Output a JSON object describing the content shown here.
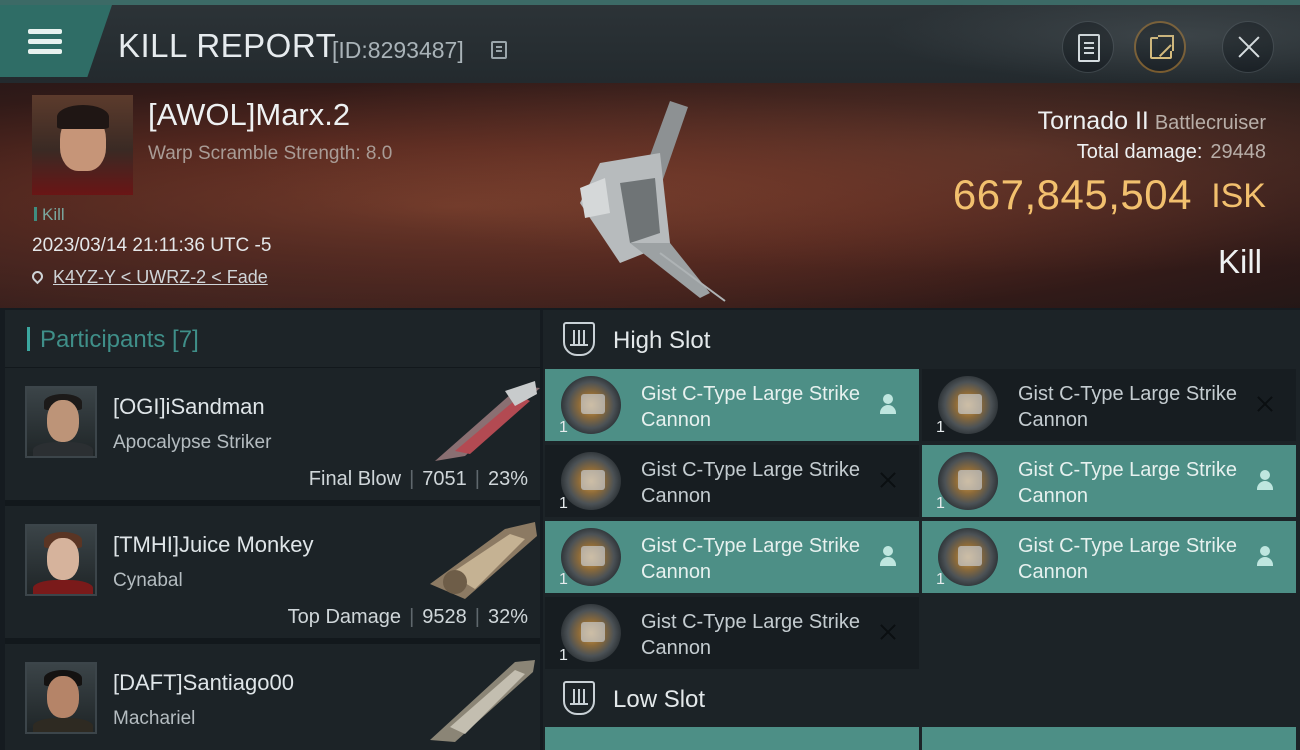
{
  "header": {
    "title": "KILL REPORT",
    "report_id": "[ID:8293487]",
    "buttons": [
      "clipboard",
      "share",
      "close"
    ]
  },
  "victim": {
    "name": "[AWOL]Marx.2",
    "warp_scramble": "Warp Scramble Strength: 8.0",
    "tag": "Kill",
    "timestamp": "2023/03/14 21:11:36 UTC -5",
    "location": "K4YZ-Y < UWRZ-2 < Fade",
    "ship_name": "Tornado II",
    "ship_class": "Battlecruiser",
    "total_damage_label": "Total damage:",
    "total_damage": "29448",
    "isk_value": "667,845,504",
    "isk_unit": "ISK",
    "outcome": "Kill"
  },
  "participants": {
    "title": "Participants [7]",
    "rows": [
      {
        "name": "[OGI]iSandman",
        "ship": "Apocalypse Striker",
        "role": "Final Blow",
        "damage": "7051",
        "percent": "23%"
      },
      {
        "name": "[TMHI]Juice Monkey",
        "ship": "Cynabal",
        "role": "Top Damage",
        "damage": "9528",
        "percent": "32%"
      },
      {
        "name": "[DAFT]Santiago00",
        "ship": "Machariel",
        "role": "",
        "damage": "",
        "percent": ""
      }
    ]
  },
  "fitting": {
    "high_slot_title": "High Slot",
    "low_slot_title": "Low Slot",
    "modules": [
      {
        "name": "Gist C-Type Large Strike Cannon",
        "qty": "1",
        "status": "dropped"
      },
      {
        "name": "Gist C-Type Large Strike Cannon",
        "qty": "1",
        "status": "destroyed"
      },
      {
        "name": "Gist C-Type Large Strike Cannon",
        "qty": "1",
        "status": "destroyed"
      },
      {
        "name": "Gist C-Type Large Strike Cannon",
        "qty": "1",
        "status": "dropped"
      },
      {
        "name": "Gist C-Type Large Strike Cannon",
        "qty": "1",
        "status": "dropped"
      },
      {
        "name": "Gist C-Type Large Strike Cannon",
        "qty": "1",
        "status": "dropped"
      },
      {
        "name": "Gist C-Type Large Strike Cannon",
        "qty": "1",
        "status": "destroyed"
      }
    ]
  },
  "colors": {
    "accent": "#3ba7a0",
    "isk": "#f2c06e",
    "dropped": "#4d8f86"
  }
}
